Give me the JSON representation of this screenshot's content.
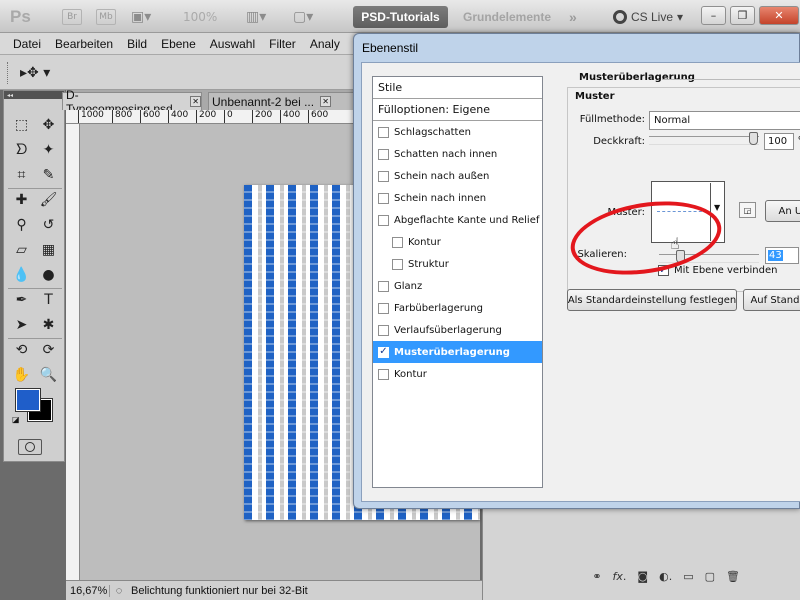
{
  "app": {
    "logo": "Ps",
    "bridge_label": "Br",
    "minibridge_label": "Mb",
    "zoom": "100%",
    "workspace_active": "PSD-Tutorials",
    "workspace_other": "Grundelemente",
    "more": "»",
    "cs_live": "CS Live"
  },
  "window_controls": {
    "minimize": "–",
    "restore": "❐",
    "close": "✕"
  },
  "menu": [
    "Datei",
    "Bearbeiten",
    "Bild",
    "Ebene",
    "Auswahl",
    "Filter",
    "Analy"
  ],
  "doc_tabs": [
    {
      "label": "D-Typocomposing.psd",
      "close": "✕"
    },
    {
      "label": "Unbenannt-2 bei ...",
      "close": "✕"
    }
  ],
  "ruler": [
    "1000",
    "800",
    "600",
    "400",
    "200",
    "0",
    "200",
    "400",
    "600"
  ],
  "status": {
    "zoom": "16,67%",
    "message": "Belichtung funktioniert nur bei 32-Bit"
  },
  "colors": {
    "foreground": "#1f5ec9",
    "background": "#000000",
    "accent": "#3399ff",
    "highlight": "#e3171d"
  },
  "dialog": {
    "title": "Ebenenstil",
    "styles_header": "Stile",
    "blend_options": "Fülloptionen: Eigene",
    "items": [
      {
        "label": "Schlagschatten",
        "checked": false,
        "indent": false
      },
      {
        "label": "Schatten nach innen",
        "checked": false,
        "indent": false
      },
      {
        "label": "Schein nach außen",
        "checked": false,
        "indent": false
      },
      {
        "label": "Schein nach innen",
        "checked": false,
        "indent": false
      },
      {
        "label": "Abgeflachte Kante und Relief",
        "checked": false,
        "indent": false
      },
      {
        "label": "Kontur",
        "checked": false,
        "indent": true
      },
      {
        "label": "Struktur",
        "checked": false,
        "indent": true
      },
      {
        "label": "Glanz",
        "checked": false,
        "indent": false
      },
      {
        "label": "Farbüberlagerung",
        "checked": false,
        "indent": false
      },
      {
        "label": "Verlaufsüberlagerung",
        "checked": false,
        "indent": false
      },
      {
        "label": "Musterüberlagerung",
        "checked": true,
        "indent": false,
        "active": true
      },
      {
        "label": "Kontur",
        "checked": false,
        "indent": false
      }
    ],
    "section_title": "Musterüberlagerung",
    "group_title": "Muster",
    "blend_mode_label": "Füllmethode:",
    "blend_mode_value": "Normal",
    "opacity_label": "Deckkraft:",
    "opacity_value": "100",
    "opacity_unit": "%",
    "pattern_label": "Muster:",
    "snap_button": "An Urs",
    "scale_label": "Skalieren:",
    "scale_value": "43",
    "link_label": "Mit Ebene verbinden",
    "link_checked": true,
    "make_default_button": "Als Standardeinstellung festlegen",
    "reset_default_button": "Auf Standa"
  },
  "tools": [
    "move-tool",
    "marquee-tool",
    "lasso-tool",
    "magic-wand-tool",
    "crop-tool",
    "eyedropper-tool",
    "healing-tool",
    "brush-tool",
    "stamp-tool",
    "history-brush-tool",
    "eraser-tool",
    "gradient-tool",
    "blur-tool",
    "dodge-tool",
    "pen-tool",
    "type-tool",
    "path-select-tool",
    "shape-tool",
    "3d-rotate-tool",
    "3d-orbit-tool",
    "hand-tool",
    "zoom-tool"
  ]
}
